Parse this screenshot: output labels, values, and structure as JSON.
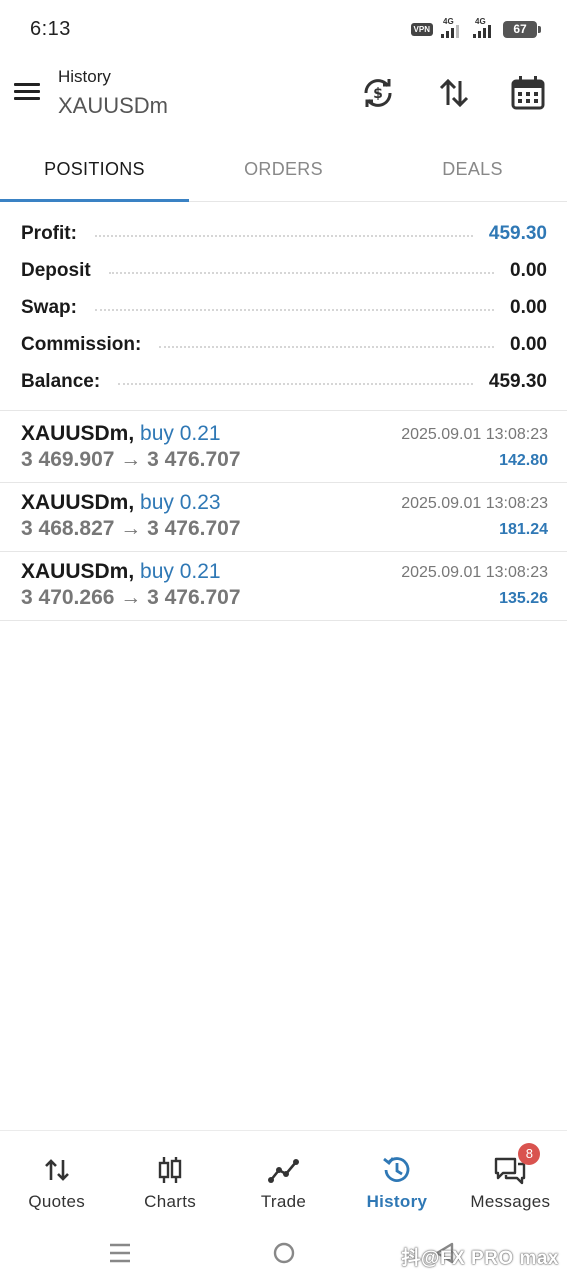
{
  "status_bar": {
    "time": "6:13",
    "vpn": "VPN",
    "network_1": "4G",
    "network_2": "4G",
    "battery": "67"
  },
  "app_bar": {
    "title": "History",
    "symbol": "XAUUSDm",
    "icons": [
      "currency-exchange-icon",
      "sort-icon",
      "calendar-icon"
    ]
  },
  "tabs": [
    {
      "label": "POSITIONS",
      "active": true
    },
    {
      "label": "ORDERS",
      "active": false
    },
    {
      "label": "DEALS",
      "active": false
    }
  ],
  "summary": [
    {
      "label": "Profit:",
      "value": "459.30",
      "accent": true
    },
    {
      "label": "Deposit",
      "value": "0.00",
      "accent": false
    },
    {
      "label": "Swap:",
      "value": "0.00",
      "accent": false
    },
    {
      "label": "Commission:",
      "value": "0.00",
      "accent": false
    },
    {
      "label": "Balance:",
      "value": "459.30",
      "accent": false
    }
  ],
  "deals": [
    {
      "symbol": "XAUUSDm,",
      "type": "buy 0.21",
      "prices": "3 469.907 → 3 476.707",
      "time": "2025.09.01 13:08:23",
      "profit": "142.80"
    },
    {
      "symbol": "XAUUSDm,",
      "type": "buy 0.23",
      "prices": "3 468.827 → 3 476.707",
      "time": "2025.09.01 13:08:23",
      "profit": "181.24"
    },
    {
      "symbol": "XAUUSDm,",
      "type": "buy 0.21",
      "prices": "3 470.266 → 3 476.707",
      "time": "2025.09.01 13:08:23",
      "profit": "135.26"
    }
  ],
  "bottom_nav": [
    {
      "label": "Quotes",
      "icon": "quotes-arrows-icon",
      "active": false
    },
    {
      "label": "Charts",
      "icon": "candlestick-icon",
      "active": false
    },
    {
      "label": "Trade",
      "icon": "trade-line-icon",
      "active": false
    },
    {
      "label": "History",
      "icon": "history-clock-icon",
      "active": true
    },
    {
      "label": "Messages",
      "icon": "messages-icon",
      "active": false,
      "badge": "8"
    }
  ],
  "watermark": "抖@FX PRO max",
  "colors": {
    "accent": "#2f78b5",
    "tab_indicator": "#3a82c4",
    "badge": "#d9534f"
  }
}
